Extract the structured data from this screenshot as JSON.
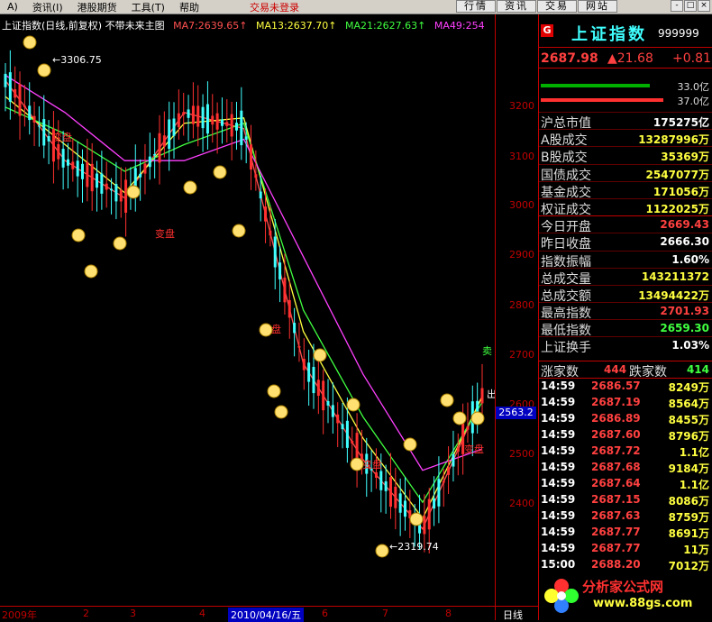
{
  "menubar": {
    "items": [
      "A)",
      "资讯(I)",
      "港股期货",
      "工具(T)",
      "帮助"
    ],
    "status": "交易未登录",
    "tabs": [
      "行情",
      "资讯",
      "交易",
      "网站"
    ],
    "window_buttons": [
      "-",
      "□",
      "×"
    ]
  },
  "chart": {
    "header": {
      "title": "上证指数(日线,前复权) 不带未来主图",
      "ma7": "MA7:2639.65↑",
      "ma13": "MA13:2637.70↑",
      "ma21": "MA21:2627.63↑",
      "ma49": "MA49:254"
    },
    "y_ticks": [
      "3200",
      "3100",
      "3000",
      "2900",
      "2800",
      "2700",
      "2600",
      "2500",
      "2400"
    ],
    "price_tag": "2563.2",
    "x_ticks": [
      "2009年",
      "2",
      "3",
      "4",
      "2010/04/16/五",
      "6",
      "7",
      "8"
    ],
    "period": "日线",
    "annotations": {
      "high": "3306.75",
      "low": "2319.74",
      "change_labels": [
        "变盘",
        "变盘",
        "变盘",
        "变盘",
        "变盘"
      ],
      "sell": "卖",
      "out": "出"
    },
    "colors": {
      "up": "#ff3030",
      "down": "#40ffff",
      "ma7": "#ff5050",
      "ma13": "#ffff40",
      "ma21": "#40ff40",
      "ma49": "#ff40ff",
      "axis": "#c00000"
    }
  },
  "chart_data": {
    "type": "line",
    "title": "上证指数(日线,前复权)",
    "ylim": [
      2300,
      3300
    ],
    "x": [
      "2009年",
      "2",
      "3",
      "4",
      "2010/04/16/五",
      "6",
      "7",
      "8"
    ],
    "series": [
      {
        "name": "MA7",
        "values": [
          3230,
          3080,
          3010,
          3170,
          3140,
          2700,
          2520,
          2390,
          2639.65
        ]
      },
      {
        "name": "MA13",
        "values": [
          3200,
          3110,
          3020,
          3150,
          3160,
          2760,
          2560,
          2410,
          2637.7
        ]
      },
      {
        "name": "MA21",
        "values": [
          3180,
          3130,
          3060,
          3110,
          3150,
          2800,
          2600,
          2440,
          2627.63
        ]
      },
      {
        "name": "MA49",
        "values": [
          3240,
          3170,
          3080,
          3080,
          3120,
          2900,
          2680,
          2500,
          2540
        ]
      }
    ],
    "annotations": {
      "high": 3306.75,
      "low": 2319.74,
      "last_marker": 2563.2
    }
  },
  "panel": {
    "badge": "G",
    "name": "上证指数",
    "code": "999999",
    "last": "2687.98",
    "change": "▲21.68",
    "pct": "+0.81",
    "bars": [
      {
        "label": "33.0亿",
        "color": "#00b000",
        "fill": 0.64
      },
      {
        "label": "37.0亿",
        "color": "#ff3030",
        "fill": 0.72
      }
    ],
    "stats": [
      {
        "label": "沪总市值",
        "value": "175275亿",
        "color": "#ffffff"
      },
      {
        "label": "A股成交",
        "value": "13287996万",
        "color": "#ffff40"
      },
      {
        "label": "B股成交",
        "value": "35369万",
        "color": "#ffff40"
      },
      {
        "label": "国债成交",
        "value": "2547077万",
        "color": "#ffff40"
      },
      {
        "label": "基金成交",
        "value": "171056万",
        "color": "#ffff40"
      },
      {
        "label": "权证成交",
        "value": "1122025万",
        "color": "#ffff40"
      },
      {
        "label": "今日开盘",
        "value": "2669.43",
        "color": "#ff4040"
      },
      {
        "label": "昨日收盘",
        "value": "2666.30",
        "color": "#ffffff"
      },
      {
        "label": "指数振幅",
        "value": "1.60%",
        "color": "#ffffff"
      },
      {
        "label": "总成交量",
        "value": "143211372",
        "color": "#ffff40"
      },
      {
        "label": "总成交额",
        "value": "13494422万",
        "color": "#ffff40"
      },
      {
        "label": "最高指数",
        "value": "2701.93",
        "color": "#ff4040"
      },
      {
        "label": "最低指数",
        "value": "2659.30",
        "color": "#40ff40"
      },
      {
        "label": "上证换手",
        "value": "1.03%",
        "color": "#ffffff"
      }
    ],
    "updown": {
      "up_label": "涨家数",
      "up": "444",
      "down_label": "跌家数",
      "down": "414"
    },
    "ticks": [
      {
        "t": "14:59",
        "p": "2686.57",
        "v": "8249万"
      },
      {
        "t": "14:59",
        "p": "2687.19",
        "v": "8564万"
      },
      {
        "t": "14:59",
        "p": "2686.89",
        "v": "8455万"
      },
      {
        "t": "14:59",
        "p": "2687.60",
        "v": "8796万"
      },
      {
        "t": "14:59",
        "p": "2687.72",
        "v": "1.1亿"
      },
      {
        "t": "14:59",
        "p": "2687.68",
        "v": "9184万"
      },
      {
        "t": "14:59",
        "p": "2687.64",
        "v": "1.1亿"
      },
      {
        "t": "14:59",
        "p": "2687.15",
        "v": "8086万"
      },
      {
        "t": "14:59",
        "p": "2687.63",
        "v": "8759万"
      },
      {
        "t": "14:59",
        "p": "2687.77",
        "v": "8691万"
      },
      {
        "t": "14:59",
        "p": "2687.77",
        "v": "11万"
      },
      {
        "t": "15:00",
        "p": "2688.20",
        "v": "7012万"
      }
    ],
    "logo": {
      "text": "分析家公式网",
      "sub": "www.88gs.com"
    }
  }
}
